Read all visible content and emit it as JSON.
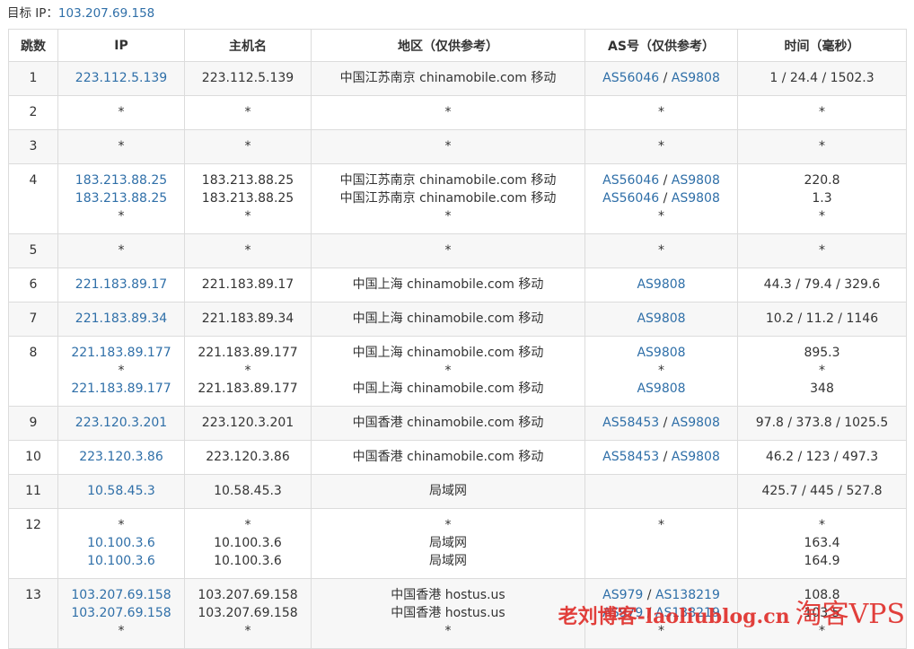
{
  "target": {
    "label": "目标 IP：",
    "ip": "103.207.69.158"
  },
  "columns": [
    "跳数",
    "IP",
    "主机名",
    "地区（仅供参考）",
    "AS号（仅供参考）",
    "时间（毫秒）"
  ],
  "rows": [
    {
      "hop": "1",
      "ip": [
        "223.112.5.139"
      ],
      "host": [
        "223.112.5.139"
      ],
      "region": [
        "中国江苏南京 chinamobile.com 移动"
      ],
      "as": [
        [
          "AS56046",
          "AS9808"
        ]
      ],
      "time": [
        "1 / 24.4 / 1502.3"
      ]
    },
    {
      "hop": "2",
      "ip": [
        "*"
      ],
      "host": [
        "*"
      ],
      "region": [
        "*"
      ],
      "as": [
        "*"
      ],
      "time": [
        "*"
      ]
    },
    {
      "hop": "3",
      "ip": [
        "*"
      ],
      "host": [
        "*"
      ],
      "region": [
        "*"
      ],
      "as": [
        "*"
      ],
      "time": [
        "*"
      ]
    },
    {
      "hop": "4",
      "ip": [
        "183.213.88.25",
        "183.213.88.25",
        "*"
      ],
      "host": [
        "183.213.88.25",
        "183.213.88.25",
        "*"
      ],
      "region": [
        "中国江苏南京 chinamobile.com 移动",
        "中国江苏南京 chinamobile.com 移动",
        "*"
      ],
      "as": [
        [
          "AS56046",
          "AS9808"
        ],
        [
          "AS56046",
          "AS9808"
        ],
        "*"
      ],
      "time": [
        "220.8",
        "1.3",
        "*"
      ]
    },
    {
      "hop": "5",
      "ip": [
        "*"
      ],
      "host": [
        "*"
      ],
      "region": [
        "*"
      ],
      "as": [
        "*"
      ],
      "time": [
        "*"
      ]
    },
    {
      "hop": "6",
      "ip": [
        "221.183.89.17"
      ],
      "host": [
        "221.183.89.17"
      ],
      "region": [
        "中国上海 chinamobile.com 移动"
      ],
      "as": [
        [
          "AS9808"
        ]
      ],
      "time": [
        "44.3 / 79.4 / 329.6"
      ]
    },
    {
      "hop": "7",
      "ip": [
        "221.183.89.34"
      ],
      "host": [
        "221.183.89.34"
      ],
      "region": [
        "中国上海 chinamobile.com 移动"
      ],
      "as": [
        [
          "AS9808"
        ]
      ],
      "time": [
        "10.2 / 11.2 / 1146"
      ]
    },
    {
      "hop": "8",
      "ip": [
        "221.183.89.177",
        "*",
        "221.183.89.177"
      ],
      "host": [
        "221.183.89.177",
        "*",
        "221.183.89.177"
      ],
      "region": [
        "中国上海 chinamobile.com 移动",
        "*",
        "中国上海 chinamobile.com 移动"
      ],
      "as": [
        [
          "AS9808"
        ],
        "*",
        [
          "AS9808"
        ]
      ],
      "time": [
        "895.3",
        "*",
        "348"
      ]
    },
    {
      "hop": "9",
      "ip": [
        "223.120.3.201"
      ],
      "host": [
        "223.120.3.201"
      ],
      "region": [
        "中国香港 chinamobile.com 移动"
      ],
      "as": [
        [
          "AS58453",
          "AS9808"
        ]
      ],
      "time": [
        "97.8 / 373.8 / 1025.5"
      ]
    },
    {
      "hop": "10",
      "ip": [
        "223.120.3.86"
      ],
      "host": [
        "223.120.3.86"
      ],
      "region": [
        "中国香港 chinamobile.com 移动"
      ],
      "as": [
        [
          "AS58453",
          "AS9808"
        ]
      ],
      "time": [
        "46.2 / 123 / 497.3"
      ]
    },
    {
      "hop": "11",
      "ip": [
        "10.58.45.3"
      ],
      "host": [
        "10.58.45.3"
      ],
      "region": [
        "局域网"
      ],
      "as": [
        ""
      ],
      "time": [
        "425.7 / 445 / 527.8"
      ]
    },
    {
      "hop": "12",
      "ip": [
        "*",
        "10.100.3.6",
        "10.100.3.6"
      ],
      "host": [
        "*",
        "10.100.3.6",
        "10.100.3.6"
      ],
      "region": [
        "*",
        "局域网",
        "局域网"
      ],
      "as": [
        "*"
      ],
      "time": [
        "*",
        "163.4",
        "164.9"
      ]
    },
    {
      "hop": "13",
      "ip": [
        "103.207.69.158",
        "103.207.69.158",
        "*"
      ],
      "host": [
        "103.207.69.158",
        "103.207.69.158",
        "*"
      ],
      "region": [
        "中国香港 hostus.us",
        "中国香港 hostus.us",
        "*"
      ],
      "as": [
        [
          "AS979",
          "AS138219"
        ],
        [
          "AS979",
          "AS138219"
        ],
        "*"
      ],
      "time": [
        "108.8",
        "103.5",
        "*"
      ]
    }
  ],
  "watermark": {
    "text1": "老刘博客-laoliublog.cn",
    "text2": "淘客VPS"
  },
  "colors": {
    "link": "#2f6fa8",
    "border": "#dcdcdc",
    "stripe": "#f7f7f7",
    "watermark": "#e0302c"
  }
}
